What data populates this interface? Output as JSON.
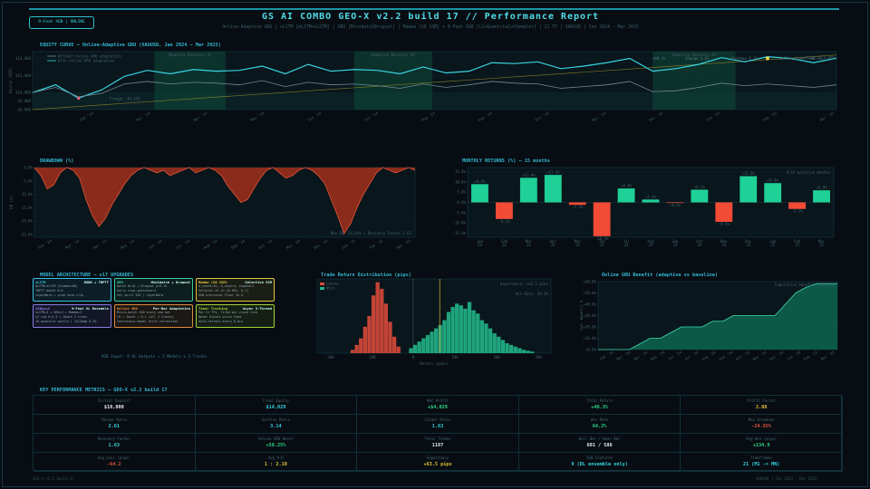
{
  "header": {
    "badge": "9-Feat XGB  |  ONLINE",
    "title": "GS AI COMBO GEO-X  v2.2  build 17  //  Performance Report",
    "subtitle": "Online-Adaptive GRU  |  xLSTM [mLSTM+sLSTM]  |  GRU [MinibatchDropout]  |  Mamba [S6 SSM]  +  9-Feat XGB [L2+QuantileCutSampler]  |  21 TF  |  XAUUSD  |  Jan 2024 - Mar 2025",
    "accent": "#52dce6"
  },
  "equity": {
    "title": "EQUITY CURVE  —  Online-Adaptive GRU  (XAUUSD, Jan 2024 — Mar 2025)",
    "ylabel": "Equity (USD)",
    "legend": [
      "Without online GRU adaptation",
      "With online GRU adaptation"
    ],
    "regions": [
      {
        "label": "Adaptive Recovery #1",
        "from": 5.3,
        "to": 8.4
      },
      {
        "label": "Adaptive Recovery #2",
        "from": 14.0,
        "to": 17.4
      },
      {
        "label": "Adaptive Recovery #3",
        "from": 27.0,
        "to": 30.6
      }
    ],
    "trough": "Trough: $9,342",
    "peak": "Peak: $14,006",
    "stats": [
      "+40.3%",
      "Sharpe 2.61",
      "Sortino 3.14",
      "Online boost +58.2%"
    ],
    "xticks": [
      "Feb '24",
      "Mar '24",
      "Apr '24",
      "May '24",
      "Jun '24",
      "Jul '24",
      "Aug '24",
      "Sep '24",
      "Oct '24",
      "Nov '24",
      "Dec '24",
      "Jan '25",
      "Feb '25",
      "Mar '25"
    ],
    "yticks": [
      "$14,000",
      "$12,000",
      "$10,000",
      "$9,000",
      "$8,000"
    ],
    "colors": {
      "adaptive": "#38d4e0",
      "baseline": "#6e8a94",
      "trough": "#e0607a",
      "peak": "#f0d040"
    }
  },
  "drawdown": {
    "title": "DRAWDOWN  (%)",
    "ylabel": "DD (%)",
    "yticks": [
      "0.0%",
      "-5.0%",
      "-10.0%",
      "-15.0%",
      "-20.0%",
      "-25.0%"
    ],
    "xticks": [
      "Feb '24",
      "Mar '24",
      "Apr '24",
      "May '24",
      "Jun '24",
      "Jul '24",
      "Aug '24",
      "Sep '24",
      "Oct '24",
      "Nov '24",
      "Dec '24",
      "Jan '25",
      "Feb '25",
      "Mar '25"
    ],
    "label": "Max DD  -24.65%   |   Recovery Factor 1.63",
    "color": "#e2553a"
  },
  "monthly": {
    "title": "MONTHLY RETURNS  (%)  —  15 months",
    "note": "9/15 positive months",
    "yticks": [
      "15.0%",
      "10.0%",
      "5.0%",
      "0.0%",
      "-5.0%",
      "-10.0%",
      "-15.0%"
    ]
  },
  "architecture": {
    "title": "MODEL ARCHITECTURE  —  v17 UPGRADES",
    "boxes": [
      {
        "name": "xLSTM",
        "tag": "RGNN + TBPTT",
        "color": "#38c2e6",
        "lines": [
          "mLSTM/sLSTM (hidden=80)",
          "TBPTT depth K=4",
          "LayerNorm + grad norm clip"
        ]
      },
      {
        "name": "GRU",
        "tag": "Minibatch + Dropout",
        "color": "#3ccf9a",
        "lines": [
          "Batch N=16  |  Dropout p=0.15",
          "Early stop patience=4",
          "Val split 20%  |  LayerNorm"
        ]
      },
      {
        "name": "Mamba (S6 SSM)",
        "tag": "Selective SSM",
        "color": "#e2c63a",
        "lines": [
          "d_state=16, d_conv=4, expand=2",
          "Softplus dt in [0.001, 0.1]",
          "SSN precision floor 1e-4"
        ]
      },
      {
        "name": "XGBoost",
        "tag": "9-Feat XL Ensemble",
        "color": "#8c7ae6",
        "lines": [
          "xLSTM+3 + GRU+3 + Mamba+3",
          "L2 reg h=1.5  |  Depth 2 trees",
          "10 quantile splits  |  ColSamp 0.50"
        ]
      },
      {
        "name": "Online GRU",
        "tag": "Per-Bar Adaptation",
        "color": "#e08a3a",
        "lines": [
          "Micro-batch SGD every new bar",
          "LR = Iaudt = 0.1  (all 3 tracks)",
          "Continuous model drift correction"
        ]
      },
      {
        "name": "Timer Tracking",
        "tag": "Async 3-Thread",
        "color": "#a4d43a",
        "lines": [
          "Per 21 TFs, fired per close tick",
          "Never blocks price feed",
          "Auto-retrain every 8 min"
        ]
      }
    ],
    "footer": "XGB Input: 9 DL Outputs  =  3 Models  x  3 Tracks"
  },
  "distribution": {
    "title": "Trade Return Distribution  (pips)",
    "legend": [
      "Losses",
      "Wins"
    ],
    "expectancy": "Expectancy:  +63.5 pips",
    "winrate": "Win Rate:  64.2%",
    "xlabel": "Return  (pips)",
    "ylabel": "Trades",
    "xticks": [
      "-200",
      "-100",
      "0",
      "100",
      "200",
      "300"
    ],
    "colors": {
      "loss": "#d9493a",
      "win": "#22b487"
    }
  },
  "benefit": {
    "title": "Online GRU Benefit  (adaptive vs baseline)",
    "label": "Cumulative benefit: +58.25%",
    "ylabel": "Cum. Benefit %",
    "yticks": [
      "+60.0%",
      "+50.0%",
      "+40.0%",
      "+30.0%",
      "+20.0%",
      "+10.0%",
      "+0.0%"
    ],
    "xticks": [
      "Feb '24",
      "Mar '24",
      "Apr '24",
      "May '24",
      "Jun '24",
      "Jul '24",
      "Aug '24",
      "Sep '24",
      "Oct '24",
      "Nov '24",
      "Dec '24",
      "Jan '25",
      "Feb '25",
      "Mar '25"
    ]
  },
  "kpi": {
    "title": "KEY PERFORMANCE METRICS  —  GEO-X v2.2 build 17",
    "cells": [
      {
        "label": "Initial Deposit",
        "value": "$10,000",
        "color": "#e8eef0"
      },
      {
        "label": "Final Equity",
        "value": "$14,029",
        "color": "#38d4e0"
      },
      {
        "label": "Net Profit",
        "value": "+$4,029",
        "color": "#2ed88a"
      },
      {
        "label": "Total Return",
        "value": "+40.3%",
        "color": "#2ed88a"
      },
      {
        "label": "Profit Factor",
        "value": "2.08",
        "color": "#e8c23a"
      },
      {
        "label": "Sharpe Ratio",
        "value": "2.61",
        "color": "#38d4e0"
      },
      {
        "label": "Sortino Ratio",
        "value": "3.14",
        "color": "#38d4e0"
      },
      {
        "label": "Calmar Ratio",
        "value": "1.63",
        "color": "#38d4e0"
      },
      {
        "label": "Win Rate",
        "value": "64.2%",
        "color": "#2ed88a"
      },
      {
        "label": "Max Drawdown",
        "value": "-24.65%",
        "color": "#e2553a"
      },
      {
        "label": "Recovery Factor",
        "value": "1.63",
        "color": "#38d4e0"
      },
      {
        "label": "Online GRU Boost",
        "value": "+58.25%",
        "color": "#2ed88a"
      },
      {
        "label": "Total Trades",
        "value": "1187",
        "color": "#e8eef0"
      },
      {
        "label": "Bull Bar / Bear Bar",
        "value": "601 / 586",
        "color": "#e8eef0"
      },
      {
        "label": "Avg Win (pips)",
        "value": "+134.9",
        "color": "#2ed88a"
      },
      {
        "label": "Avg Loss (pips)",
        "value": "-64.2",
        "color": "#e2553a"
      },
      {
        "label": "Avg R:R",
        "value": "1 : 2.10",
        "color": "#e8c23a"
      },
      {
        "label": "Expectancy",
        "value": "+63.5 pips",
        "color": "#e8c23a"
      },
      {
        "label": "XGB Features",
        "value": "9  (DL ensemble only)",
        "color": "#38d4e0"
      },
      {
        "label": "Timeframes",
        "value": "21  (M1 -> MN)",
        "color": "#38d4e0"
      }
    ]
  },
  "footer": {
    "left": "GEO-X  v2.2  build 17",
    "right": "XAUUSD  |  Jan 2024 - Mar 2025"
  },
  "chart_data": [
    {
      "type": "line",
      "title": "EQUITY CURVE  —  Online-Adaptive GRU  (XAUUSD, Jan 2024 — Mar 2025)",
      "ylabel": "Equity (USD)",
      "ylim": [
        8000,
        14800
      ],
      "x_range": [
        "2024-01",
        "2025-03"
      ],
      "series": [
        {
          "name": "With online GRU adaptation",
          "values": [
            10000,
            10900,
            9342,
            10300,
            11900,
            12600,
            12200,
            12700,
            12500,
            12600,
            13100,
            12200,
            13300,
            12500,
            12700,
            12600,
            12200,
            13000,
            12300,
            12500,
            13500,
            13400,
            13600,
            12800,
            13100,
            13500,
            14000,
            12500,
            12800,
            13300,
            14100,
            13600,
            14200,
            14000,
            13500,
            14029
          ]
        },
        {
          "name": "Without online GRU adaptation",
          "values": [
            10000,
            10600,
            9500,
            9900,
            11000,
            11300,
            11000,
            11200,
            11100,
            10900,
            11400,
            10700,
            11200,
            10900,
            11000,
            10800,
            10500,
            11000,
            10600,
            10900,
            11300,
            11100,
            11000,
            10500,
            10700,
            10900,
            11300,
            10100,
            10200,
            10600,
            11100,
            10800,
            11000,
            10800,
            10600,
            10900
          ]
        }
      ],
      "annotations": [
        "Trough: $9,342",
        "Peak: $14,006"
      ]
    },
    {
      "type": "area",
      "title": "DRAWDOWN  (%)",
      "ylabel": "DD (%)",
      "ylim": [
        -26,
        0
      ],
      "values": [
        0,
        -3,
        -8,
        -6.5,
        -2,
        0,
        -1,
        -4,
        -12,
        -18,
        -22,
        -19,
        -14,
        -10,
        -6,
        -3,
        -1,
        0,
        -1,
        -2,
        -1,
        -3,
        -2,
        -1,
        0,
        -2,
        -1,
        0,
        -1,
        -3,
        -7,
        -10,
        -13,
        -12,
        -8,
        -4,
        -1,
        0,
        -2,
        -4,
        -3,
        -1,
        0,
        -1,
        -3,
        -6,
        -12,
        -18,
        -24.65,
        -21,
        -15,
        -10,
        -6,
        -2,
        0,
        -1,
        -2,
        -1,
        0,
        -1
      ],
      "annotations": [
        "Max DD  -24.65%",
        "Recovery Factor 1.63"
      ]
    },
    {
      "type": "bar",
      "title": "MONTHLY RETURNS  (%)  —  15 months",
      "categories": [
        "Jan 24",
        "Feb 24",
        "Mar 24",
        "Apr 24",
        "May 24",
        "Jun 24",
        "Jul 24",
        "Aug 24",
        "Sep 24",
        "Oct 24",
        "Nov 24",
        "Dec 24",
        "Jan 25",
        "Feb 25",
        "Mar 25"
      ],
      "values": [
        8.9,
        -8.1,
        12.0,
        13.4,
        -1.2,
        -16.5,
        6.8,
        1.4,
        -0.3,
        6.2,
        -9.5,
        12.8,
        9.4,
        -3.2,
        5.9
      ],
      "ylim": [
        -17,
        17
      ]
    },
    {
      "type": "bar",
      "title": "Trade Return Distribution  (pips)",
      "xlabel": "Return  (pips)",
      "series": [
        {
          "name": "Losses",
          "x": [
            -150,
            -140,
            -130,
            -120,
            -110,
            -100,
            -90,
            -80,
            -70,
            -60,
            -50,
            -40
          ],
          "values": [
            4,
            10,
            18,
            32,
            45,
            70,
            86,
            78,
            60,
            38,
            20,
            8
          ]
        },
        {
          "name": "Wins",
          "x": [
            -10,
            0,
            10,
            20,
            30,
            40,
            50,
            60,
            70,
            80,
            90,
            100,
            110,
            120,
            130,
            140,
            150,
            160,
            170,
            180,
            190,
            200,
            210,
            220,
            230,
            240,
            250,
            260,
            270,
            280
          ],
          "values": [
            6,
            10,
            14,
            18,
            22,
            26,
            30,
            34,
            40,
            50,
            56,
            60,
            58,
            54,
            62,
            52,
            48,
            40,
            36,
            30,
            24,
            20,
            16,
            12,
            10,
            8,
            6,
            4,
            3,
            2
          ]
        }
      ],
      "annotations": [
        "Expectancy:  +63.5 pips",
        "Win Rate:  64.2%"
      ]
    },
    {
      "type": "area",
      "title": "Online GRU Benefit  (adaptive vs baseline)",
      "ylabel": "Cum. Benefit %",
      "ylim": [
        0,
        60
      ],
      "x_range": [
        "2024-01",
        "2025-03"
      ],
      "values": [
        0,
        0,
        0,
        0,
        5,
        10,
        10,
        15,
        20,
        20,
        20,
        25,
        25,
        30,
        30,
        30,
        30,
        30,
        40,
        50,
        55,
        58.25,
        58.25,
        58.25
      ],
      "annotations": [
        "Cumulative benefit: +58.25%"
      ]
    }
  ]
}
